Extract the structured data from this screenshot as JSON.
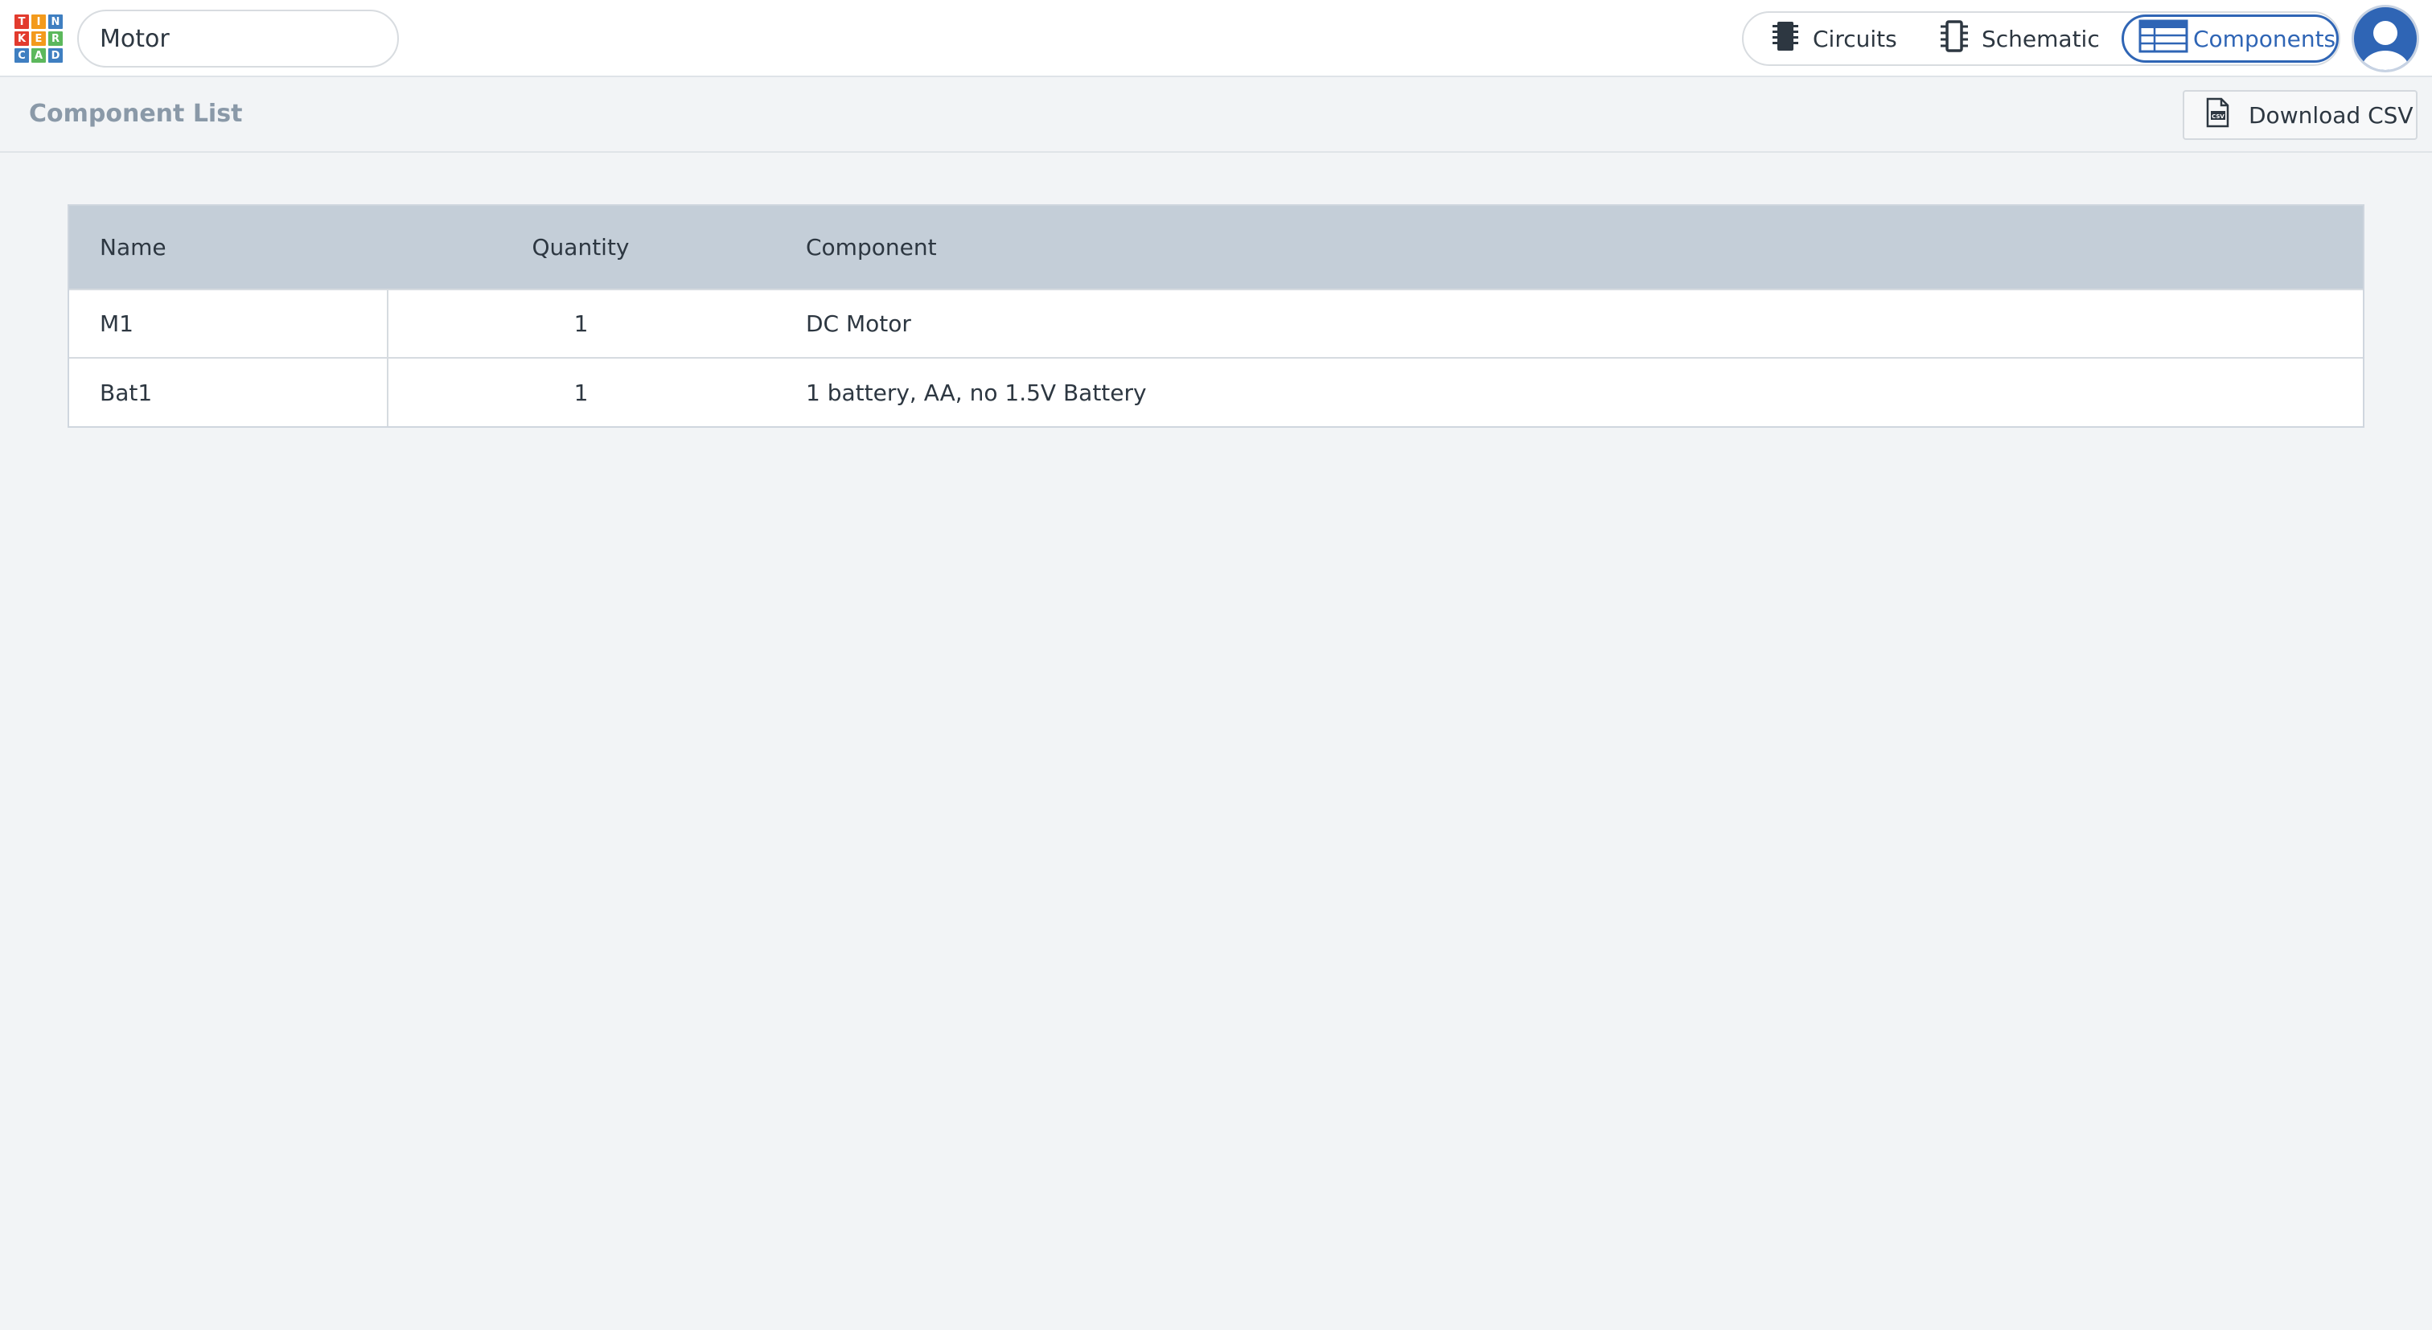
{
  "header": {
    "logo_letters": [
      "T",
      "I",
      "N",
      "K",
      "E",
      "R",
      "C",
      "A",
      "D"
    ],
    "logo_colors": [
      "#e23b2e",
      "#f39a1c",
      "#3f7fc1",
      "#e23b2e",
      "#f39a1c",
      "#5cb85c",
      "#3f7fc1",
      "#5cb85c",
      "#3f7fc1"
    ],
    "project_name": "Motor",
    "views": {
      "circuits_label": "Circuits",
      "schematic_label": "Schematic",
      "components_label": "Components",
      "active": "Components"
    }
  },
  "subheader": {
    "title": "Component List",
    "download_label": "Download CSV"
  },
  "table": {
    "columns": [
      "Name",
      "Quantity",
      "Component"
    ],
    "rows": [
      {
        "name": "M1",
        "quantity": "1",
        "component": "DC Motor"
      },
      {
        "name": "Bat1",
        "quantity": "1",
        "component": "1 battery, AA, no 1.5V Battery"
      }
    ]
  },
  "colors": {
    "accent": "#2f65b5",
    "table_header_bg": "#c4ced8",
    "page_bg": "#f2f4f6"
  },
  "icons": {
    "circuits": "chip-icon",
    "schematic": "schematic-icon",
    "components": "table-list-icon",
    "download": "csv-file-icon",
    "avatar": "user-avatar-icon"
  }
}
